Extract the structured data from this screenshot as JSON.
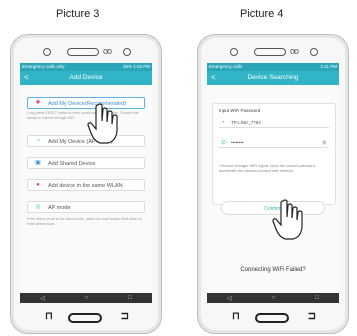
{
  "labels": {
    "picture3": "Picture 3",
    "picture4": "Picture 4"
  },
  "phone3": {
    "status_left": "Emergency calls only",
    "status_right": "35% 1:02 PM",
    "header_back": "<",
    "header_title": "Add Device",
    "buttons": [
      {
        "label": "Add My Device(Recommended)",
        "icon": "plus-icon"
      },
      {
        "label": "Add My Device (AP mode)",
        "icon": "wifi-icon"
      },
      {
        "label": "Add Shared Device",
        "icon": "share-icon"
      },
      {
        "label": "Add device in the same WLAN",
        "icon": "lan-icon"
      },
      {
        "label": "AP mode",
        "icon": "ap-icon"
      }
    ],
    "note1": "Long press RESET button to enter smart connection mode. Connect the device to internet through WiFi.",
    "note2": "If the device is set to the direct mode, press the reset button three times to enter direct mode."
  },
  "phone4": {
    "status_left": "Emergency calls",
    "status_right": "1:11 PM",
    "header_back": "<",
    "header_title": "Device Searching",
    "wifi_title": "Input WiFi Password",
    "ssid": "TP-LINK_778A",
    "password": "••••••••",
    "hint": "*Choose stronger WiFi signal, input the correct password, accelerate the camera connect with Internet.",
    "confirm": "Confirm",
    "conn_fail": "Connecting WiFi Failed?"
  },
  "colors": {
    "accent": "#30b4c6",
    "status": "#2aa6b8",
    "highlight": "#5fb2e8"
  }
}
